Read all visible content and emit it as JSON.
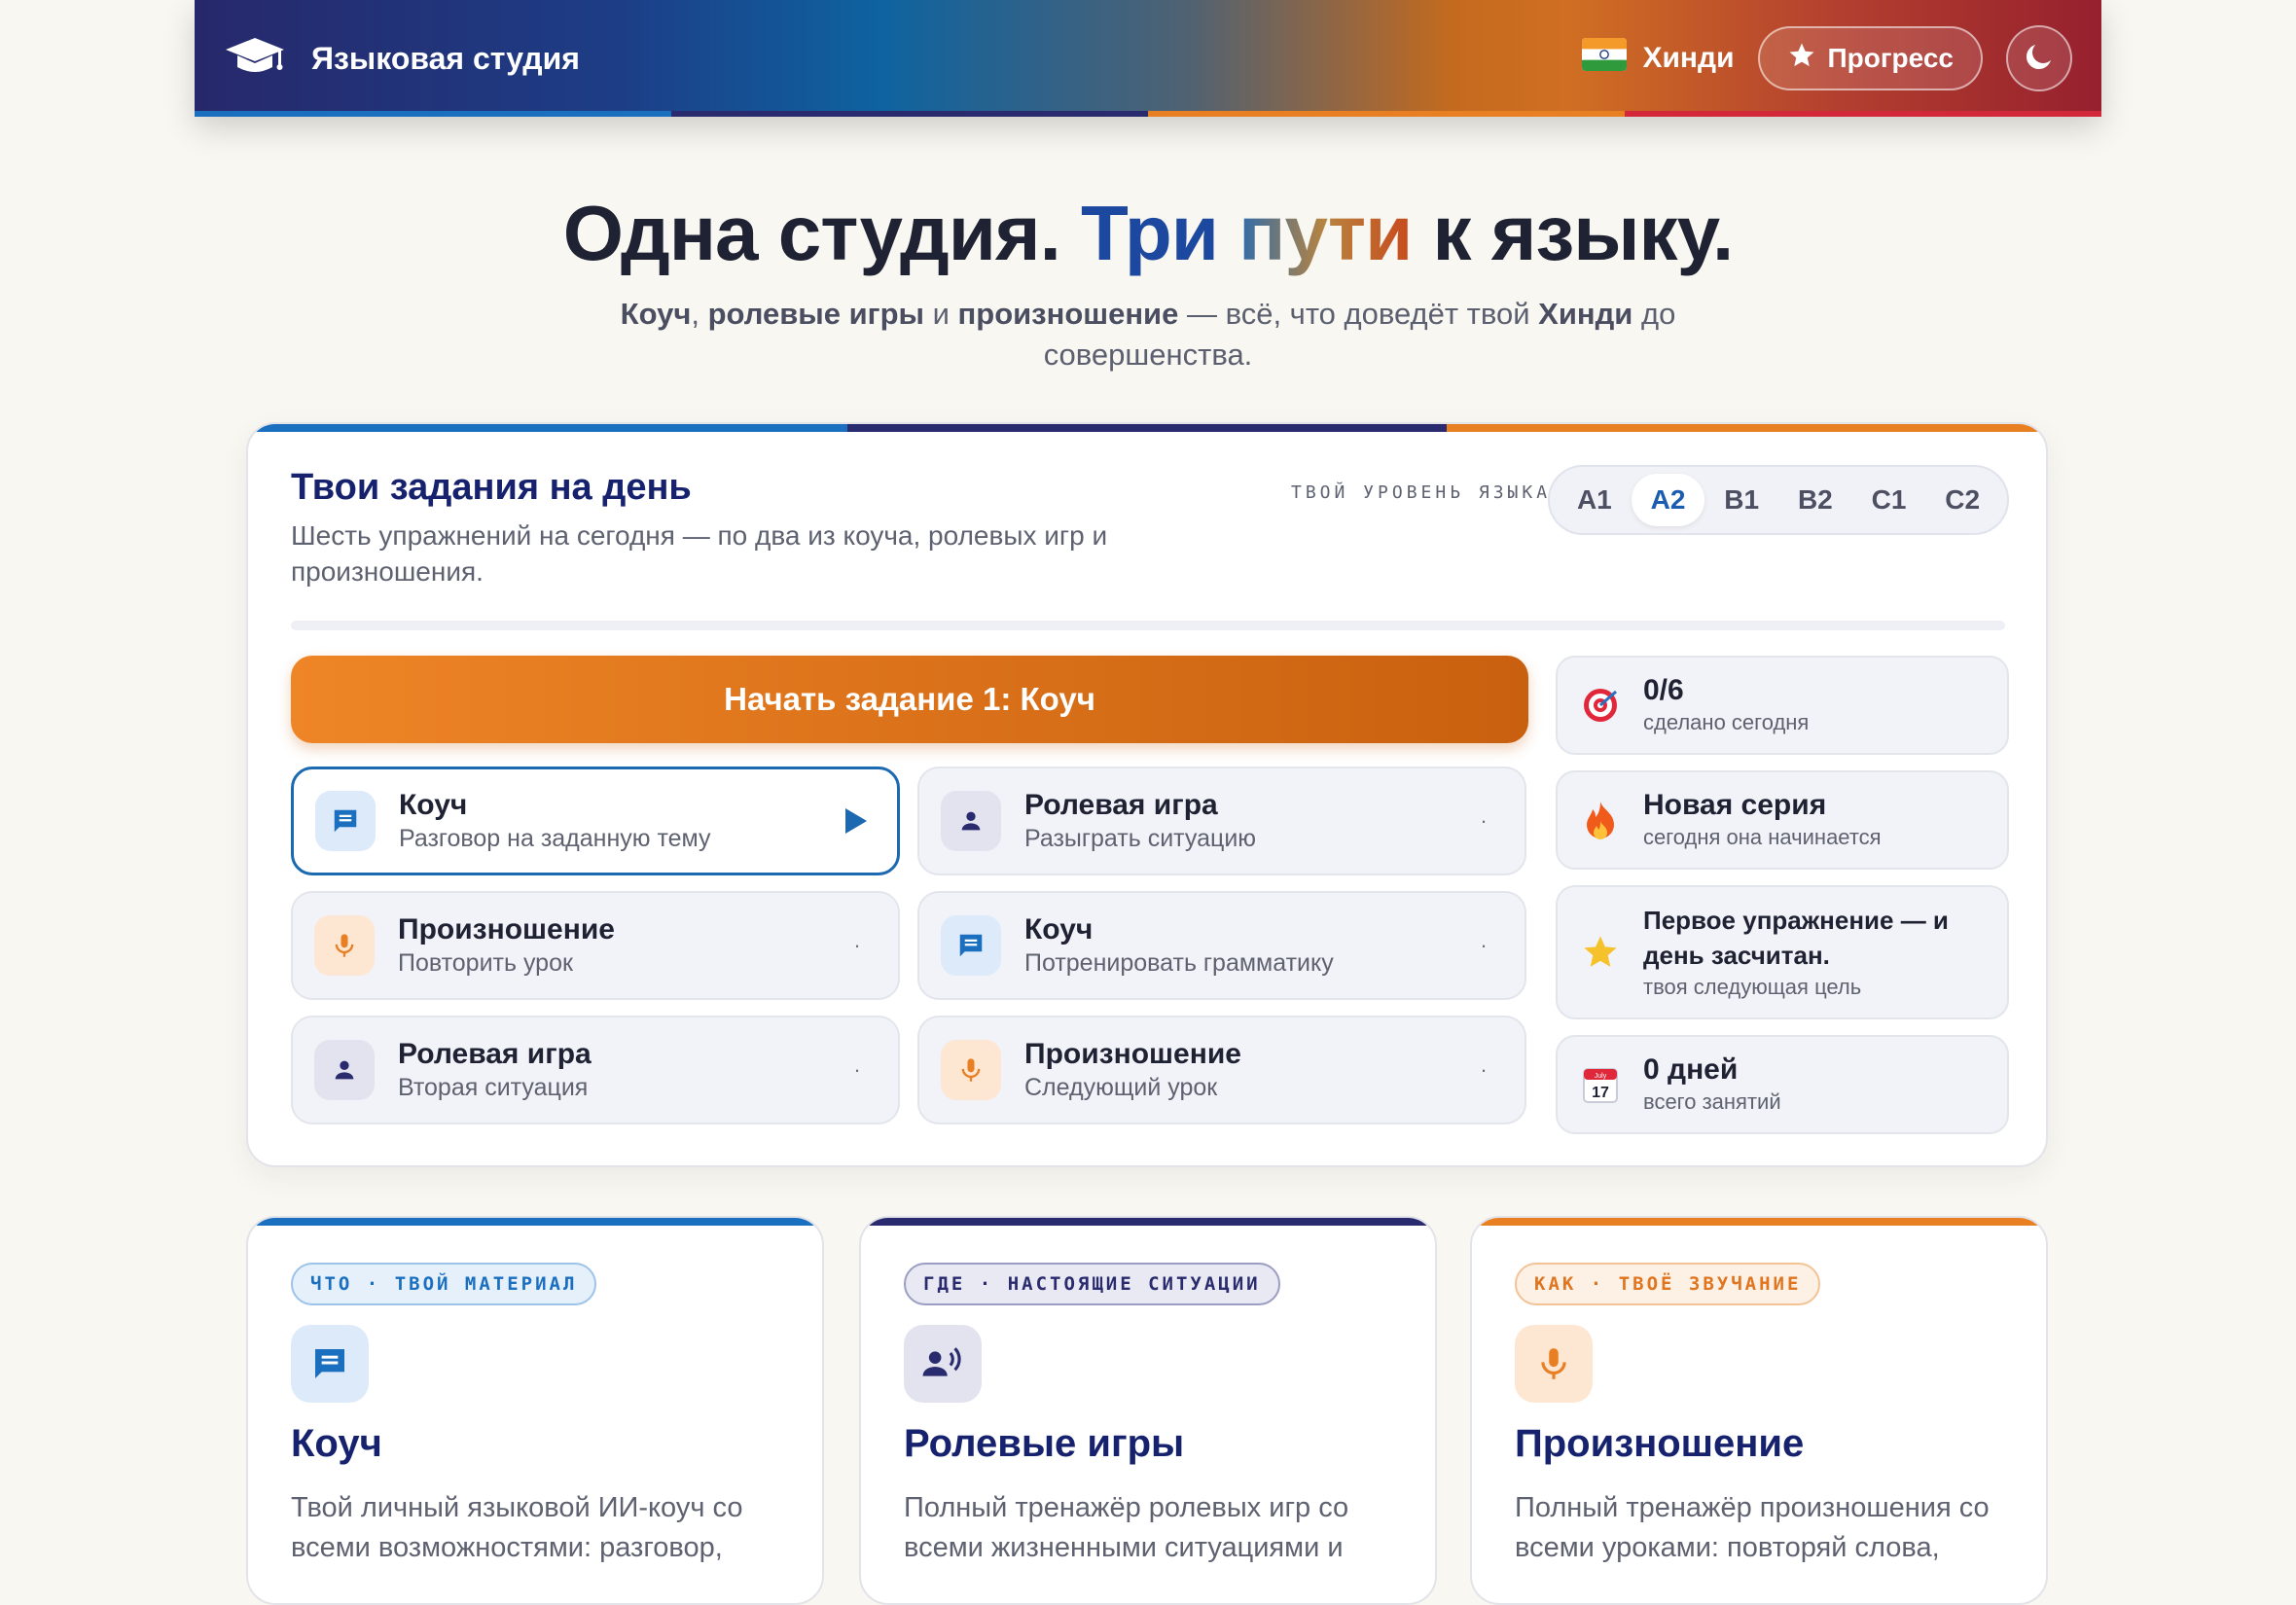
{
  "header": {
    "brand_title": "Языковая студия",
    "language_name": "Хинди",
    "progress_label": "Прогресс",
    "gradient": [
      "#27286b",
      "#0e63a0",
      "#d06f23",
      "#96202e"
    ],
    "stripe_colors": [
      "#1b6fbf",
      "#2a2b6e",
      "#e97f23",
      "#d2283a"
    ]
  },
  "hero": {
    "title_part1": "Одна студия. ",
    "title_word_tri": "Три",
    "title_space": " ",
    "title_word_puti": "пути",
    "title_part2": " к языку.",
    "sub_coach": "Коуч",
    "sub_sep1": ", ",
    "sub_roleplay": "ролевые игры",
    "sub_and": " и ",
    "sub_pron": "произношение",
    "sub_middle": " — всё, что доведёт твой ",
    "sub_lang": "Хинди",
    "sub_end": " до совершенства."
  },
  "daily": {
    "title": "Твои задания на день",
    "description": "Шесть упражнений на сегодня — по два из коуча, ролевых игр и произношения.",
    "level_label": "ТВОЙ УРОВЕНЬ ЯЗЫКА",
    "levels": [
      "A1",
      "A2",
      "B1",
      "B2",
      "C1",
      "C2"
    ],
    "active_level": "A2",
    "start_button": "Начать задание 1: Коуч",
    "stripe_colors": [
      "#1b6fbf",
      "#2a2b6e",
      "#e97f23"
    ],
    "tasks": [
      {
        "title": "Коуч",
        "subtitle": "Разговор на заданную тему",
        "kind": "coach",
        "state": "▶"
      },
      {
        "title": "Ролевая игра",
        "subtitle": "Разыграть ситуацию",
        "kind": "roleplay",
        "state": "·"
      },
      {
        "title": "Произношение",
        "subtitle": "Повторить урок",
        "kind": "pron",
        "state": "·"
      },
      {
        "title": "Коуч",
        "subtitle": "Потренировать грамматику",
        "kind": "coach",
        "state": "·"
      },
      {
        "title": "Ролевая игра",
        "subtitle": "Вторая ситуация",
        "kind": "roleplay",
        "state": "·"
      },
      {
        "title": "Произношение",
        "subtitle": "Следующий урок",
        "kind": "pron",
        "state": "·"
      }
    ],
    "stats": [
      {
        "title": "0/6",
        "subtitle": "сделано сегодня",
        "icon": "target-icon"
      },
      {
        "title": "Новая серия",
        "subtitle": "сегодня она начинается",
        "icon": "fire-icon"
      },
      {
        "title": "Первое упражнение — и день засчитан.",
        "subtitle": "твоя следующая цель",
        "icon": "star-icon"
      },
      {
        "title": "0 дней",
        "subtitle": "всего занятий",
        "icon": "calendar-icon",
        "calendar_day": "17",
        "calendar_month": "July"
      }
    ]
  },
  "features": [
    {
      "tag_left": "ЧТО",
      "tag_dot": "·",
      "tag_right": "ТВОЙ МАТЕРИАЛ",
      "title": "Коуч",
      "description": "Твой личный языковой ИИ-коуч со всеми возможностями: разговор,",
      "accent": "#1b6fbf",
      "icon": "chat-icon"
    },
    {
      "tag_left": "ГДЕ",
      "tag_dot": "·",
      "tag_right": "НАСТОЯЩИЕ СИТУАЦИИ",
      "title": "Ролевые игры",
      "description": "Полный тренажёр ролевых игр со всеми жизненными ситуациями и",
      "accent": "#2a2b6e",
      "icon": "speaking-person-icon"
    },
    {
      "tag_left": "КАК",
      "tag_dot": "·",
      "tag_right": "ТВОЁ ЗВУЧАНИЕ",
      "title": "Произношение",
      "description": "Полный тренажёр произношения со всеми уроками: повторяй слова,",
      "accent": "#e97f23",
      "icon": "microphone-icon"
    }
  ]
}
